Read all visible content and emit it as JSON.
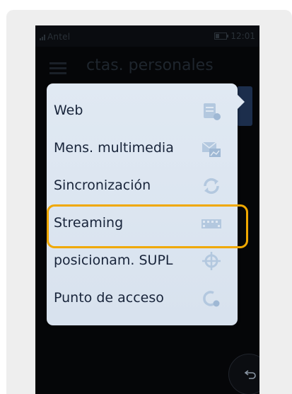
{
  "status_bar": {
    "carrier": "Antel",
    "time": "12:01"
  },
  "header": {
    "title": "ctas. personales"
  },
  "menu": {
    "items": [
      {
        "label": "Web",
        "icon": "web-page-icon"
      },
      {
        "label": "Mens. multimedia",
        "icon": "mms-envelope-icon"
      },
      {
        "label": "Sincronización",
        "icon": "sync-icon"
      },
      {
        "label": "Streaming",
        "icon": "film-strip-icon"
      },
      {
        "label": "posicionam. SUPL",
        "icon": "crosshair-icon"
      },
      {
        "label": "Punto de acceso",
        "icon": "access-point-icon"
      }
    ],
    "highlighted_item": "Streaming"
  },
  "colors": {
    "menu_background": "#dde6f0",
    "menu_text": "#18243a",
    "highlight": "#f0a800",
    "icon": "#b3c8df"
  }
}
